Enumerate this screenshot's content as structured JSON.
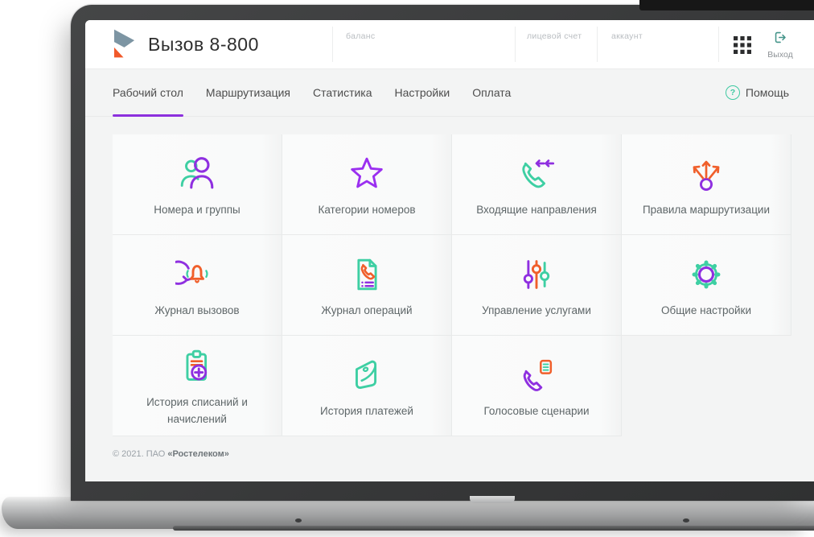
{
  "header": {
    "title": "Вызов 8-800",
    "meta_labels": [
      "баланс",
      "лицевой счет",
      "аккаунт"
    ],
    "logout_label": "Выход"
  },
  "nav": {
    "tabs": [
      {
        "label": "Рабочий стол",
        "active": true
      },
      {
        "label": "Маршрутизация",
        "active": false
      },
      {
        "label": "Статистика",
        "active": false
      },
      {
        "label": "Настройки",
        "active": false
      },
      {
        "label": "Оплата",
        "active": false
      }
    ],
    "help_label": "Помощь",
    "help_glyph": "?"
  },
  "tiles": [
    {
      "label": "Номера и группы",
      "icon": "users-icon"
    },
    {
      "label": "Категории номеров",
      "icon": "star-icon"
    },
    {
      "label": "Входящие направления",
      "icon": "incoming-call-icon"
    },
    {
      "label": "Правила маршрутизации",
      "icon": "routing-icon"
    },
    {
      "label": "Журнал вызовов",
      "icon": "call-log-icon"
    },
    {
      "label": "Журнал операций",
      "icon": "operations-log-icon"
    },
    {
      "label": "Управление услугами",
      "icon": "services-sliders-icon"
    },
    {
      "label": "Общие настройки",
      "icon": "settings-gear-icon"
    },
    {
      "label": "История списаний и начислений",
      "icon": "charges-history-icon"
    },
    {
      "label": "История платежей",
      "icon": "payments-history-icon"
    },
    {
      "label": "Голосовые сценарии",
      "icon": "voice-scenarios-icon"
    }
  ],
  "footer": {
    "copyright_prefix": "© 2021. ПАО ",
    "company": "«Ростелеком»"
  },
  "colors": {
    "accent_purple": "#8f2fe0",
    "accent_teal": "#3ecfa3",
    "accent_orange": "#f05f2b",
    "tab_underline": "#8c30dd",
    "logo_slate": "#7d95a3",
    "logo_orange": "#f1592a",
    "bezel": "#3a3b3c"
  }
}
